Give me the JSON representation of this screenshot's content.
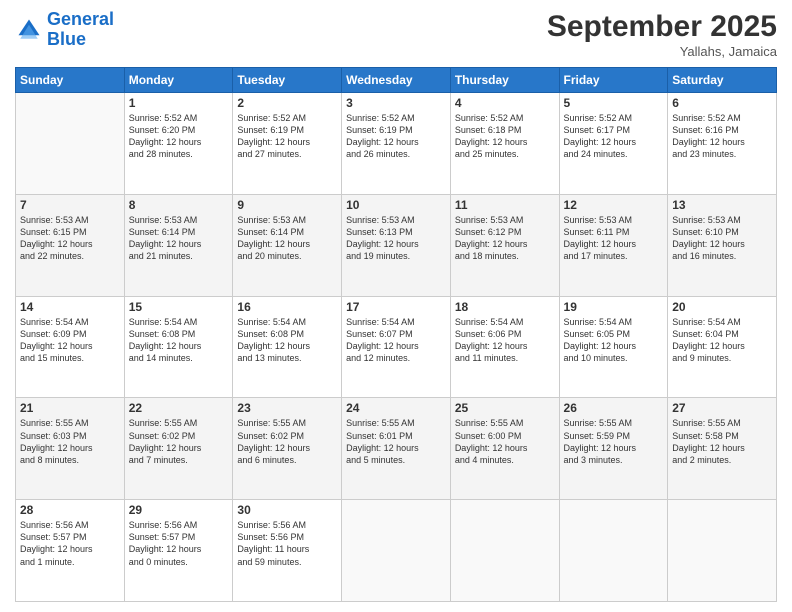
{
  "header": {
    "logo_line1": "General",
    "logo_line2": "Blue",
    "month": "September 2025",
    "location": "Yallahs, Jamaica"
  },
  "days_of_week": [
    "Sunday",
    "Monday",
    "Tuesday",
    "Wednesday",
    "Thursday",
    "Friday",
    "Saturday"
  ],
  "weeks": [
    [
      {
        "day": "",
        "info": ""
      },
      {
        "day": "1",
        "info": "Sunrise: 5:52 AM\nSunset: 6:20 PM\nDaylight: 12 hours\nand 28 minutes."
      },
      {
        "day": "2",
        "info": "Sunrise: 5:52 AM\nSunset: 6:19 PM\nDaylight: 12 hours\nand 27 minutes."
      },
      {
        "day": "3",
        "info": "Sunrise: 5:52 AM\nSunset: 6:19 PM\nDaylight: 12 hours\nand 26 minutes."
      },
      {
        "day": "4",
        "info": "Sunrise: 5:52 AM\nSunset: 6:18 PM\nDaylight: 12 hours\nand 25 minutes."
      },
      {
        "day": "5",
        "info": "Sunrise: 5:52 AM\nSunset: 6:17 PM\nDaylight: 12 hours\nand 24 minutes."
      },
      {
        "day": "6",
        "info": "Sunrise: 5:52 AM\nSunset: 6:16 PM\nDaylight: 12 hours\nand 23 minutes."
      }
    ],
    [
      {
        "day": "7",
        "info": "Sunrise: 5:53 AM\nSunset: 6:15 PM\nDaylight: 12 hours\nand 22 minutes."
      },
      {
        "day": "8",
        "info": "Sunrise: 5:53 AM\nSunset: 6:14 PM\nDaylight: 12 hours\nand 21 minutes."
      },
      {
        "day": "9",
        "info": "Sunrise: 5:53 AM\nSunset: 6:14 PM\nDaylight: 12 hours\nand 20 minutes."
      },
      {
        "day": "10",
        "info": "Sunrise: 5:53 AM\nSunset: 6:13 PM\nDaylight: 12 hours\nand 19 minutes."
      },
      {
        "day": "11",
        "info": "Sunrise: 5:53 AM\nSunset: 6:12 PM\nDaylight: 12 hours\nand 18 minutes."
      },
      {
        "day": "12",
        "info": "Sunrise: 5:53 AM\nSunset: 6:11 PM\nDaylight: 12 hours\nand 17 minutes."
      },
      {
        "day": "13",
        "info": "Sunrise: 5:53 AM\nSunset: 6:10 PM\nDaylight: 12 hours\nand 16 minutes."
      }
    ],
    [
      {
        "day": "14",
        "info": "Sunrise: 5:54 AM\nSunset: 6:09 PM\nDaylight: 12 hours\nand 15 minutes."
      },
      {
        "day": "15",
        "info": "Sunrise: 5:54 AM\nSunset: 6:08 PM\nDaylight: 12 hours\nand 14 minutes."
      },
      {
        "day": "16",
        "info": "Sunrise: 5:54 AM\nSunset: 6:08 PM\nDaylight: 12 hours\nand 13 minutes."
      },
      {
        "day": "17",
        "info": "Sunrise: 5:54 AM\nSunset: 6:07 PM\nDaylight: 12 hours\nand 12 minutes."
      },
      {
        "day": "18",
        "info": "Sunrise: 5:54 AM\nSunset: 6:06 PM\nDaylight: 12 hours\nand 11 minutes."
      },
      {
        "day": "19",
        "info": "Sunrise: 5:54 AM\nSunset: 6:05 PM\nDaylight: 12 hours\nand 10 minutes."
      },
      {
        "day": "20",
        "info": "Sunrise: 5:54 AM\nSunset: 6:04 PM\nDaylight: 12 hours\nand 9 minutes."
      }
    ],
    [
      {
        "day": "21",
        "info": "Sunrise: 5:55 AM\nSunset: 6:03 PM\nDaylight: 12 hours\nand 8 minutes."
      },
      {
        "day": "22",
        "info": "Sunrise: 5:55 AM\nSunset: 6:02 PM\nDaylight: 12 hours\nand 7 minutes."
      },
      {
        "day": "23",
        "info": "Sunrise: 5:55 AM\nSunset: 6:02 PM\nDaylight: 12 hours\nand 6 minutes."
      },
      {
        "day": "24",
        "info": "Sunrise: 5:55 AM\nSunset: 6:01 PM\nDaylight: 12 hours\nand 5 minutes."
      },
      {
        "day": "25",
        "info": "Sunrise: 5:55 AM\nSunset: 6:00 PM\nDaylight: 12 hours\nand 4 minutes."
      },
      {
        "day": "26",
        "info": "Sunrise: 5:55 AM\nSunset: 5:59 PM\nDaylight: 12 hours\nand 3 minutes."
      },
      {
        "day": "27",
        "info": "Sunrise: 5:55 AM\nSunset: 5:58 PM\nDaylight: 12 hours\nand 2 minutes."
      }
    ],
    [
      {
        "day": "28",
        "info": "Sunrise: 5:56 AM\nSunset: 5:57 PM\nDaylight: 12 hours\nand 1 minute."
      },
      {
        "day": "29",
        "info": "Sunrise: 5:56 AM\nSunset: 5:57 PM\nDaylight: 12 hours\nand 0 minutes."
      },
      {
        "day": "30",
        "info": "Sunrise: 5:56 AM\nSunset: 5:56 PM\nDaylight: 11 hours\nand 59 minutes."
      },
      {
        "day": "",
        "info": ""
      },
      {
        "day": "",
        "info": ""
      },
      {
        "day": "",
        "info": ""
      },
      {
        "day": "",
        "info": ""
      }
    ]
  ]
}
